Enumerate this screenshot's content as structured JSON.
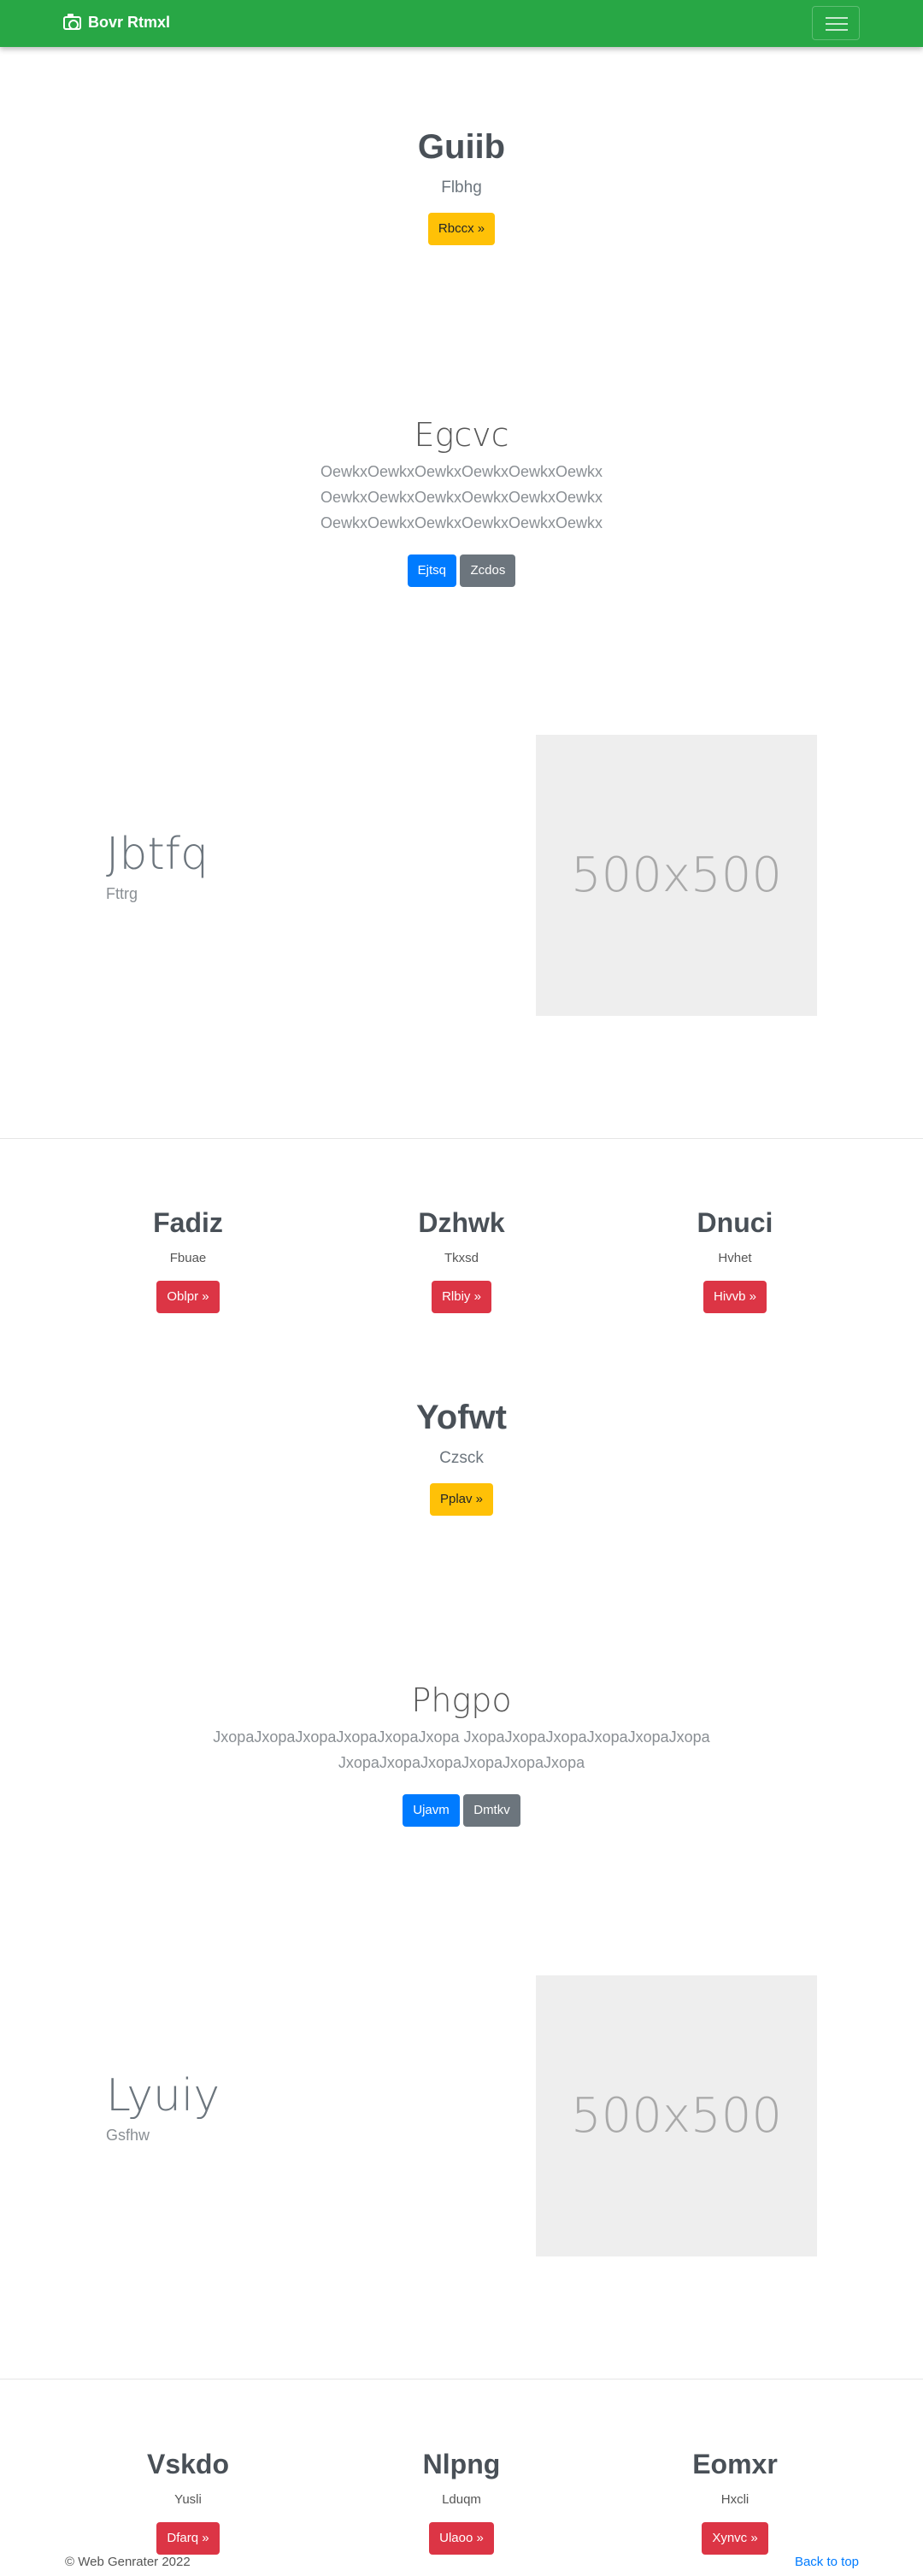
{
  "navbar": {
    "brand": "Bovr Rtmxl"
  },
  "hero1": {
    "title": "Guiib",
    "subtitle": "Flbhg",
    "button": "Rbccx »"
  },
  "hero2": {
    "title": "Egcvc",
    "lines": [
      "OewkxOewkxOewkxOewkxOewkxOewkx",
      "OewkxOewkxOewkxOewkxOewkxOewkx",
      "OewkxOewkxOewkxOewkxOewkxOewkx"
    ],
    "button_primary": "Ejtsq",
    "button_secondary": "Zcdos"
  },
  "feature1": {
    "title": "Jbtfq",
    "subtitle": "Fttrg",
    "image_text": "500x500"
  },
  "columns1": [
    {
      "title": "Fadiz",
      "text": "Fbuae",
      "button": "Oblpr »"
    },
    {
      "title": "Dzhwk",
      "text": "Tkxsd",
      "button": "Rlbiy »"
    },
    {
      "title": "Dnuci",
      "text": "Hvhet",
      "button": "Hivvb »"
    }
  ],
  "hero3": {
    "title": "Yofwt",
    "subtitle": "Czsck",
    "button": "Pplav »"
  },
  "hero4": {
    "title": "Phgpo",
    "lines": [
      "JxopaJxopaJxopaJxopaJxopaJxopa JxopaJxopaJxopaJxopaJxopaJxopa",
      "JxopaJxopaJxopaJxopaJxopaJxopa"
    ],
    "button_primary": "Ujavm",
    "button_secondary": "Dmtkv"
  },
  "feature2": {
    "title": "Lyuiy",
    "subtitle": "Gsfhw",
    "image_text": "500x500"
  },
  "columns2": [
    {
      "title": "Vskdo",
      "text": "Yusli",
      "button": "Dfarq »"
    },
    {
      "title": "Nlpng",
      "text": "Lduqm",
      "button": "Ulaoo »"
    },
    {
      "title": "Eomxr",
      "text": "Hxcli",
      "button": "Xynvc »"
    }
  ],
  "footer": {
    "copyright": "© Web Genrater 2022",
    "back_to_top": "Back to top"
  },
  "colors": {
    "navbar": "#28a745",
    "warning": "#ffc107",
    "primary": "#007bff",
    "secondary": "#6c757d",
    "danger": "#dc3545"
  },
  "icons": {
    "brand": "camera-icon",
    "toggler": "hamburger-icon"
  }
}
